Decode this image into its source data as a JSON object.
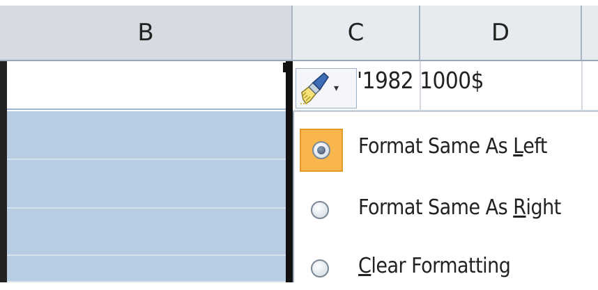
{
  "columns": [
    "B",
    "C",
    "D"
  ],
  "cell_value": "'1982 1000$",
  "paste_options": {
    "icon": "paintbrush-icon",
    "arrow": "▾"
  },
  "menu": {
    "items": [
      {
        "pre": "Format Same As ",
        "accel": "L",
        "post": "eft",
        "selected": true
      },
      {
        "pre": "Format Same As ",
        "accel": "R",
        "post": "ight",
        "selected": false
      },
      {
        "pre": "",
        "accel": "C",
        "post": "lear Formatting",
        "selected": false
      }
    ]
  },
  "colors": {
    "selection_fill": "#b8cce4",
    "highlight": "#f8b64c",
    "header_bg": "#dfe3e8"
  }
}
